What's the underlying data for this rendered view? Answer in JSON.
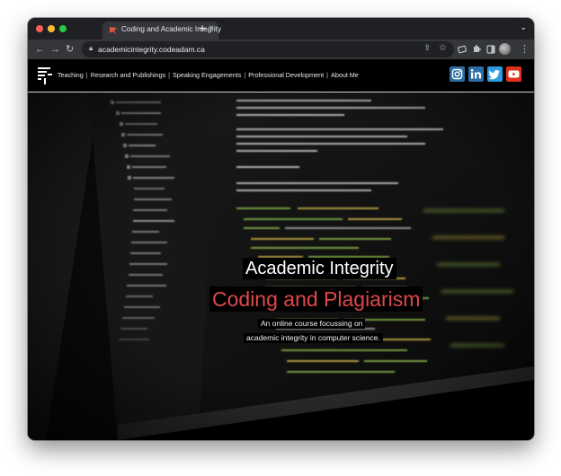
{
  "browser": {
    "tab": {
      "title": "Coding and Academic Integrity",
      "close_glyph": "×"
    },
    "new_tab_glyph": "+",
    "tab_menu_glyph": "⌄",
    "url": "academicintegrity.codeadam.ca"
  },
  "site": {
    "nav": [
      {
        "label": "Teaching"
      },
      {
        "label": "Research and Publishings"
      },
      {
        "label": "Speaking Engagements"
      },
      {
        "label": "Professional Development"
      },
      {
        "label": "About Me"
      }
    ],
    "separator": "|",
    "social": [
      {
        "name": "instagram-icon",
        "color": "#2e6da4"
      },
      {
        "name": "linkedin-icon",
        "color": "#2e6da4"
      },
      {
        "name": "twitter-icon",
        "color": "#2e9be0"
      },
      {
        "name": "youtube-icon",
        "color": "#e0301e"
      }
    ]
  },
  "hero": {
    "title": "Academic Integrity",
    "subtitle": "Coding and Plagiarism",
    "description_line1": "An online course focussing on",
    "description_line2": "academic integrity in computer science."
  },
  "colors": {
    "accent_red": "#e04848"
  }
}
